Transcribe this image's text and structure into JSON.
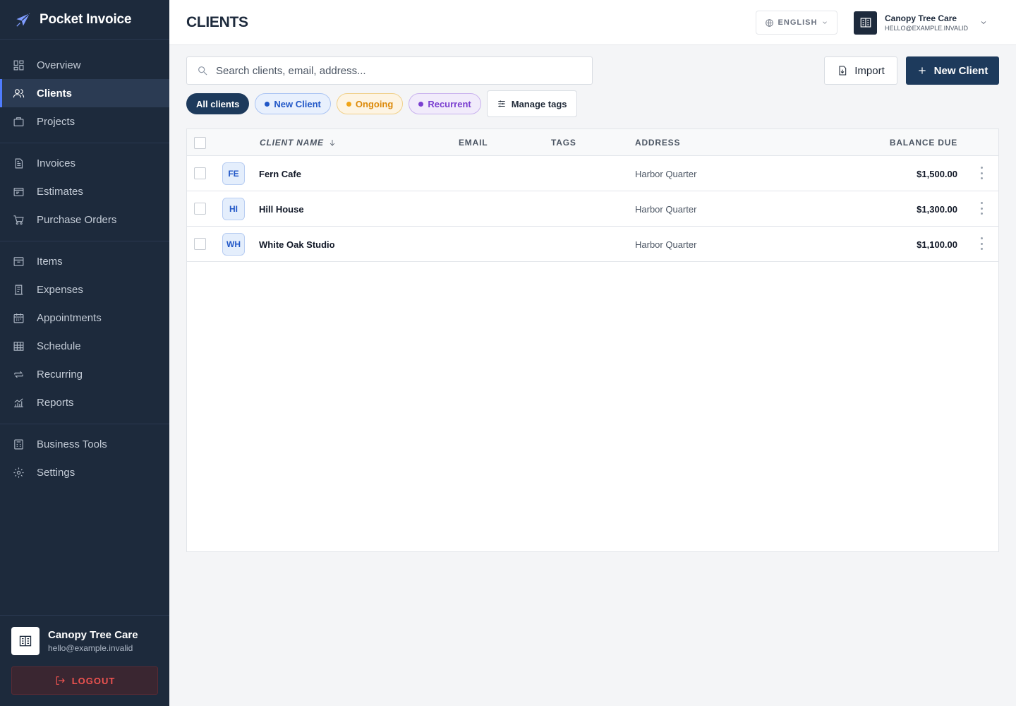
{
  "brand": {
    "name": "Pocket Invoice",
    "icon": "paper-plane-icon"
  },
  "sidebar": {
    "groups": [
      [
        {
          "label": "Overview",
          "icon": "dashboard-icon"
        },
        {
          "label": "Clients",
          "icon": "users-icon",
          "active": true
        },
        {
          "label": "Projects",
          "icon": "briefcase-icon"
        }
      ],
      [
        {
          "label": "Invoices",
          "icon": "document-icon"
        },
        {
          "label": "Estimates",
          "icon": "estimate-icon"
        },
        {
          "label": "Purchase Orders",
          "icon": "cart-icon"
        }
      ],
      [
        {
          "label": "Items",
          "icon": "box-icon"
        },
        {
          "label": "Expenses",
          "icon": "receipt-icon"
        },
        {
          "label": "Appointments",
          "icon": "calendar-icon"
        },
        {
          "label": "Schedule",
          "icon": "grid-icon"
        },
        {
          "label": "Recurring",
          "icon": "repeat-icon"
        },
        {
          "label": "Reports",
          "icon": "chart-icon"
        }
      ],
      [
        {
          "label": "Business Tools",
          "icon": "calculator-icon"
        },
        {
          "label": "Settings",
          "icon": "gear-icon"
        }
      ]
    ],
    "account": {
      "name": "Canopy Tree Care",
      "email": "hello@example.invalid"
    },
    "logout_label": "LOGOUT"
  },
  "header": {
    "title": "CLIENTS",
    "language": "ENGLISH",
    "user": {
      "name": "Canopy Tree Care",
      "email": "HELLO@EXAMPLE.INVALID"
    }
  },
  "toolbar": {
    "search_placeholder": "Search clients, email, address...",
    "import_label": "Import",
    "new_client_label": "New Client"
  },
  "filters": {
    "all": "All clients",
    "new_client": "New Client",
    "ongoing": "Ongoing",
    "recurrent": "Recurrent",
    "manage": "Manage tags"
  },
  "colors": {
    "sidebar_bg": "#1d2a3c",
    "primary": "#1d3a5c",
    "accent": "#4f7cff",
    "tag_new": "#2157c7",
    "tag_ongoing": "#dc8a0a",
    "tag_recurrent": "#7a3fd0",
    "logout": "#ef5350"
  },
  "table": {
    "columns": {
      "name": "CLIENT NAME",
      "email": "EMAIL",
      "tags": "TAGS",
      "address": "ADDRESS",
      "balance": "BALANCE DUE"
    },
    "rows": [
      {
        "initials": "FE",
        "name": "Fern Cafe",
        "email": "",
        "tags": "",
        "address": "Harbor Quarter",
        "balance": "$1,500.00"
      },
      {
        "initials": "HI",
        "name": "Hill House",
        "email": "",
        "tags": "",
        "address": "Harbor Quarter",
        "balance": "$1,300.00"
      },
      {
        "initials": "WH",
        "name": "White Oak Studio",
        "email": "",
        "tags": "",
        "address": "Harbor Quarter",
        "balance": "$1,100.00"
      }
    ]
  }
}
